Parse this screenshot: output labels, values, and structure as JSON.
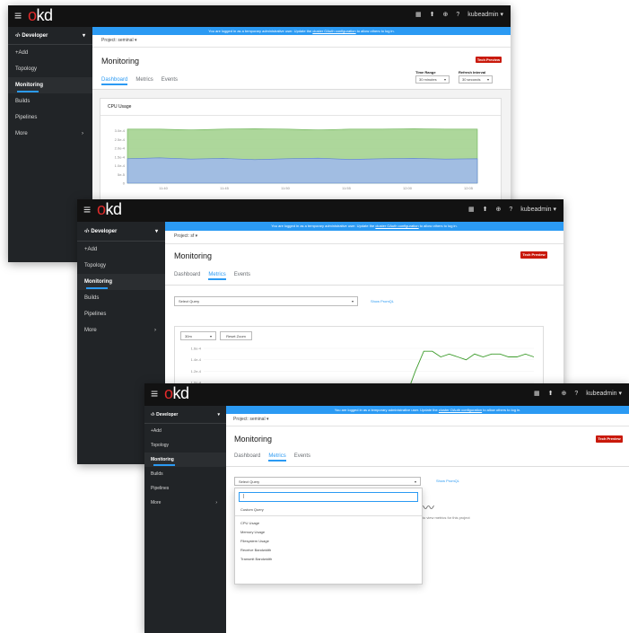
{
  "brand": {
    "logo_o": "o",
    "logo_rest": "kd"
  },
  "masthead": {
    "user": "kubeadmin",
    "hamburger": "≡",
    "grid_icon": "▦",
    "import_icon": "⬆",
    "plus_icon": "⊕",
    "help_icon": "?",
    "caret": "▾"
  },
  "banner": {
    "pre": "You are logged in as a temporary administrative user. Update the ",
    "link": "cluster OAuth configuration",
    "post": " to allow others to log in."
  },
  "sidebar": {
    "perspective": "Developer",
    "perspective_icon": "‹/›",
    "items": [
      "+Add",
      "Topology",
      "Monitoring",
      "Builds",
      "Pipelines",
      "More"
    ]
  },
  "page": {
    "title": "Monitoring",
    "tabs": [
      "Dashboard",
      "Metrics",
      "Events"
    ],
    "badge": "Tech Preview"
  },
  "shot1": {
    "project": "Project: seminal",
    "time_range_label": "Time Range",
    "time_range_value": "30 minutes",
    "refresh_label": "Refresh Interval",
    "refresh_value": "30 seconds",
    "card_title": "CPU Usage"
  },
  "shot2": {
    "project": "Project: sf",
    "select_query": "Select Query",
    "show_promql": "Show PromQL",
    "range_value": "30m",
    "reset_zoom": "Reset Zoom"
  },
  "shot3": {
    "project": "Project: seminal",
    "select_query": "Select Query",
    "show_promql": "Show PromQL",
    "custom_query": "Custom Query",
    "options": [
      "CPU Usage",
      "Memory Usage",
      "Filesystem Usage",
      "Receive Bandwidth",
      "Transmit Bandwidth"
    ],
    "hint": "...en to view metrics for this project"
  },
  "chart_data": [
    {
      "type": "area",
      "title": "CPU Usage",
      "x": [
        "11:40",
        "11:45",
        "11:50",
        "11:55",
        "12:00",
        "12:05"
      ],
      "y_ticks": [
        "0",
        "5e-5",
        "1.0e-4",
        "1.5e-4",
        "2.0e-4",
        "2.5e-4",
        "3.0e-4"
      ],
      "series": [
        {
          "color": "#9fd08a",
          "values": [
            0.00031,
            0.00031,
            0.000305,
            0.00031,
            0.000312,
            0.00031,
            0.000305,
            0.00031,
            0.00031,
            0.000312,
            0.00031,
            0.00031
          ]
        },
        {
          "color": "#9fb8ee",
          "values": [
            0.00014,
            0.000145,
            0.000138,
            0.000142,
            0.000135,
            0.00014,
            0.000143,
            0.000136,
            0.00014,
            0.000142,
            0.000138,
            0.00014
          ]
        }
      ]
    },
    {
      "type": "line",
      "y_ticks": [
        "1.6e-4",
        "1.4e-4",
        "1.2e-4",
        "1.0e-4",
        "8.0e-5",
        "6.0e-5",
        "4.0e-5"
      ],
      "series": [
        {
          "color": "#3d9c2c",
          "values": [
            null,
            null,
            null,
            null,
            null,
            null,
            null,
            null,
            null,
            null,
            null,
            null,
            null,
            null,
            null,
            null,
            null,
            null,
            null,
            null,
            null,
            null,
            null,
            4e-05,
            8e-05,
            0.00012,
            0.000155,
            0.000155,
            0.000145,
            0.00015,
            0.000145,
            0.00014,
            0.00015,
            0.000145,
            0.00015,
            0.00015,
            0.000145,
            0.000145,
            0.00015,
            0.000145
          ]
        },
        {
          "color": "#3e63b8",
          "values": [
            9e-05,
            8.5e-05,
            9e-05,
            8.2e-05,
            9e-05,
            8.8e-05,
            9e-05,
            8e-05,
            9e-05,
            8.5e-05,
            9e-05,
            9e-05,
            8.5e-05,
            9e-05,
            8e-05,
            9e-05,
            8.5e-05,
            9e-05,
            9.2e-05,
            8.5e-05,
            9e-05,
            8.6e-05,
            9e-05,
            9e-05,
            8.5e-05,
            9.5e-05,
            9e-05,
            9e-05,
            8.8e-05,
            9.2e-05,
            9e-05,
            8.8e-05,
            9e-05,
            9e-05,
            8.6e-05,
            9e-05,
            9e-05,
            8.8e-05,
            9e-05,
            9e-05
          ]
        }
      ]
    }
  ]
}
